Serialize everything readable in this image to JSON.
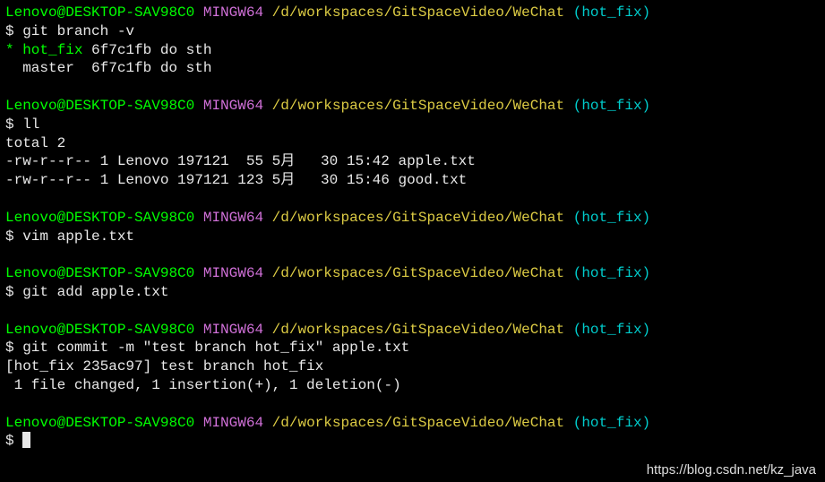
{
  "prompt": {
    "user": "Lenovo",
    "at": "@",
    "host": "DESKTOP-SAV98C0",
    "mingw": " MINGW64",
    "path": " /d/workspaces/GitSpaceVideo/WeChat",
    "branch": " (hot_fix)"
  },
  "blocks": [
    {
      "command": "$ git branch -v",
      "output": [
        {
          "type": "branches",
          "current": "* hot_fix",
          "restCurrent": " 6f7c1fb do sth",
          "other": "  master  6f7c1fb do sth"
        }
      ]
    },
    {
      "command": "$ ll",
      "output": [
        {
          "type": "plain",
          "text": "total 2"
        },
        {
          "type": "plain",
          "text": "-rw-r--r-- 1 Lenovo 197121  55 5月   30 15:42 apple.txt"
        },
        {
          "type": "plain",
          "text": "-rw-r--r-- 1 Lenovo 197121 123 5月   30 15:46 good.txt"
        }
      ]
    },
    {
      "command": "$ vim apple.txt",
      "output": []
    },
    {
      "command": "$ git add apple.txt",
      "output": []
    },
    {
      "command": "$ git commit -m \"test branch hot_fix\" apple.txt",
      "output": [
        {
          "type": "plain",
          "text": "[hot_fix 235ac97] test branch hot_fix"
        },
        {
          "type": "plain",
          "text": " 1 file changed, 1 insertion(+), 1 deletion(-)"
        }
      ]
    },
    {
      "command": "$ ",
      "cursor": true,
      "output": []
    }
  ],
  "watermark": "https://blog.csdn.net/kz_java"
}
